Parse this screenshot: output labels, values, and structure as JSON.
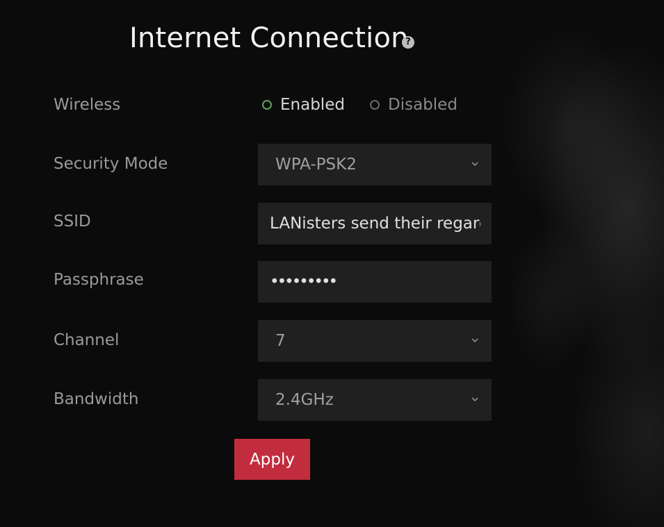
{
  "title": "Internet Connection",
  "help_icon": "question-circle-icon",
  "wireless": {
    "label": "Wireless",
    "options": [
      "Enabled",
      "Disabled"
    ],
    "selected": "Enabled"
  },
  "security_mode": {
    "label": "Security Mode",
    "value": "WPA-PSK2"
  },
  "ssid": {
    "label": "SSID",
    "value": "LANisters send their regards"
  },
  "passphrase": {
    "label": "Passphrase",
    "value": "•••••••••"
  },
  "channel": {
    "label": "Channel",
    "value": "7"
  },
  "bandwidth": {
    "label": "Bandwidth",
    "value": "2.4GHz"
  },
  "apply_label": "Apply",
  "colors": {
    "accent": "#c22d3e",
    "enabled_ring": "#5fa35a",
    "field_bg": "#202020"
  }
}
